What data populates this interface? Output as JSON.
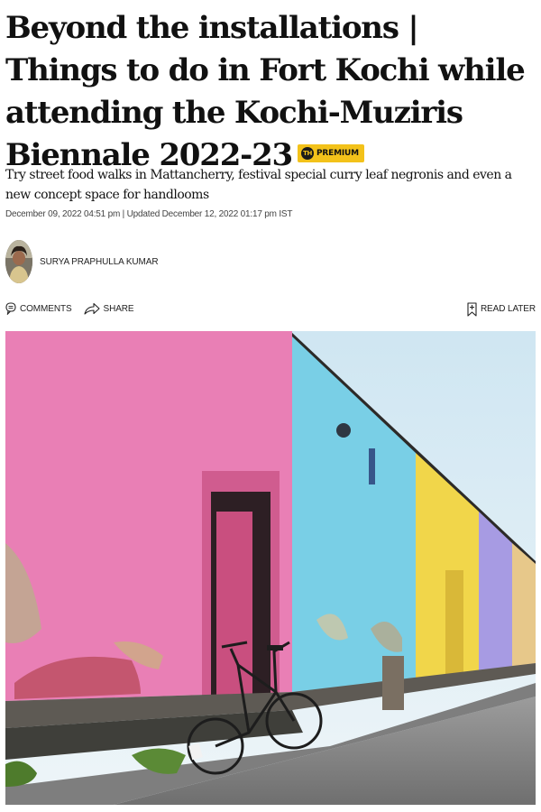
{
  "article": {
    "headline": "Beyond the installations | Things to do in Fort Kochi while attending the Kochi-Muziris Biennale 2022-23",
    "badge": {
      "logo_text": "TH",
      "label": "PREMIUM",
      "color": "#f3c21a"
    },
    "subheading": "Try street food walks in Mattancherry, festival special curry leaf negronis and even a new concept space for handlooms",
    "dates": "December 09, 2022 04:51 pm | Updated December 12, 2022 01:17 pm IST",
    "author": {
      "name": "SURYA PRAPHULLA KUMAR"
    }
  },
  "actions": {
    "comments": {
      "label": "COMMENTS",
      "icon": "comment-icon"
    },
    "share": {
      "label": "SHARE",
      "icon": "share-icon"
    },
    "read_later": {
      "label": "READ LATER",
      "icon": "bookmark-icon"
    }
  },
  "colors": {
    "premium_badge": "#f3c21a",
    "wall_pink": "#e97fb5",
    "wall_blue": "#79cfe6",
    "wall_yellow": "#f1d64a",
    "wall_purple": "#a79be3"
  }
}
